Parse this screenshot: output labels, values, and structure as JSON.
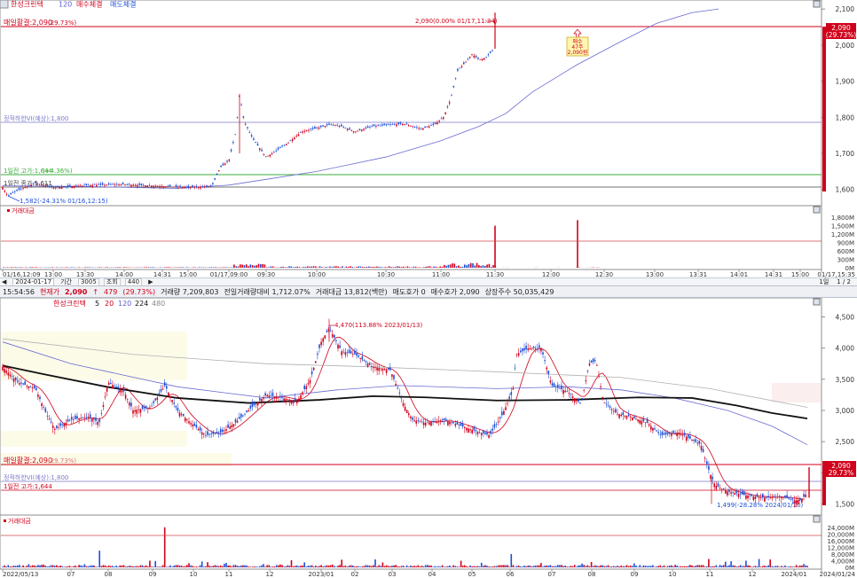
{
  "intraday": {
    "title_items": [
      "한성크린텍",
      "120",
      "매수체결",
      "매도체결"
    ],
    "title_colors": [
      "#d0021b",
      "#5b5bd6",
      "#d0021b",
      "#1e4fd8"
    ],
    "price_ticks": [
      "2,100",
      "2,000",
      "1,900",
      "1,800",
      "1,700",
      "1,600"
    ],
    "price_tick_values": [
      2100,
      2000,
      1900,
      1800,
      1700,
      1600
    ],
    "time_labels": [
      "01/16,12:09",
      "13:00",
      "13:30",
      "14:00",
      "14:31",
      "15:00",
      "01/17,09:00",
      "09:30",
      "10:00",
      "10:30",
      "11:00",
      "11:30",
      "12:00",
      "12:30",
      "13:00",
      "13:31",
      "14:01",
      "14:31",
      "15:00",
      "01/17,15:35"
    ],
    "labels": {
      "limit_up": "매일활결:2,090",
      "limit_up_sub": "(29.73%)",
      "upper_line": "정적하한VI(예상):1,800",
      "prev_high": "1일전 고가:1,644",
      "prev_high_sub": "(+4.36%)",
      "prev_close": "1일전 종가:1,611",
      "low_ann": "1,582(-24.31% 01/16,12:15)",
      "high_ann": "2,090(0.00% 01/17,11:34)",
      "buy_box": [
        "매수",
        "47주",
        "2,090원"
      ],
      "last_price": "2,090",
      "last_pct": "(29.73%)"
    },
    "volume_label": "거래대금",
    "volume_ticks": [
      "1,800M",
      "1,500M",
      "1,200M",
      "900M",
      "600M",
      "300M",
      "0M"
    ]
  },
  "controls": {
    "date": "2024-01-17",
    "period": "기간",
    "count": "3005",
    "lookup": "조회",
    "count2": "440",
    "page": "1일",
    "pager": "1 / 2"
  },
  "infobar": {
    "time": "15:54:56",
    "label_current": "현재가",
    "current_price": "2,090",
    "arrow": "↑",
    "change": "479",
    "change_pct": "(29.73%)",
    "volume": "거래량 7,209,803",
    "vol_ratio": "전일거래량대비 1,712.07%",
    "amount": "거래대금 13,812(백만)",
    "ask": "매도호가 0",
    "bid": "매수호가 2,090",
    "shares": "상장주수 50,035,429"
  },
  "daily": {
    "title_items": [
      "한성크린텍",
      "5",
      "20",
      "120",
      "224",
      "480"
    ],
    "title_colors": [
      "#d0021b",
      "#111111",
      "#d0021b",
      "#5b5bd6",
      "#111111",
      "#8a8a8a"
    ],
    "price_ticks": [
      "4,500",
      "4,000",
      "3,500",
      "3,000",
      "2,500",
      "2,000",
      "1,500"
    ],
    "price_tick_values": [
      4500,
      4000,
      3500,
      3000,
      2500,
      2000,
      1500
    ],
    "time_labels": [
      "2022/05/13",
      "07",
      "08",
      "09",
      "10",
      "11",
      "12",
      "2023/01",
      "02",
      "03",
      "04",
      "05",
      "06",
      "07",
      "08",
      "09",
      "10",
      "11",
      "12",
      "2024/01",
      "2024/01/24"
    ],
    "labels": {
      "limit_up": "매일활결:2,090",
      "limit_up_sub": "(29.73%)",
      "upper_line": "정적하한VI(예상):1,800",
      "prev_high": "1일전 고가:1,644",
      "high_ann": "4,470(113.88% 2023/01/13)",
      "low_ann": "1,499(-28.28% 2024/01/10)",
      "last_price": "2,090",
      "last_pct": "29.73%"
    },
    "volume_label": "거래대금",
    "volume_ticks": [
      "24,000M",
      "20,000M",
      "16,000M",
      "12,000M",
      "8,000M",
      "4,000M",
      "0M"
    ]
  },
  "chart_data": [
    {
      "type": "candlestick",
      "title": "한성크린텍",
      "x_range": [
        "01/16,12:09",
        "01/17,15:35"
      ],
      "ylim": [
        1560,
        2120
      ],
      "key_points": [
        {
          "label": "low",
          "x": "01/16,12:15",
          "y": 1582
        },
        {
          "label": "open_01/17",
          "x": "01/17,09:00",
          "y": 1650
        },
        {
          "label": "spike",
          "x": "01/17,09:15",
          "y": 1865
        },
        {
          "label": "09:30",
          "x": "01/17,09:30",
          "y": 1680
        },
        {
          "label": "10:00",
          "x": "01/17,10:00",
          "y": 1770
        },
        {
          "label": "10:30",
          "x": "01/17,10:30",
          "y": 1775
        },
        {
          "label": "11:00",
          "x": "01/17,11:00",
          "y": 1810
        },
        {
          "label": "11:15",
          "x": "01/17,11:15",
          "y": 1960
        },
        {
          "label": "high",
          "x": "01/17,11:34",
          "y": 2090
        }
      ],
      "reference_lines": [
        2090,
        1800,
        1644,
        1611
      ],
      "volume_ylim": [
        0,
        1900
      ],
      "volume_spikes_M": [
        {
          "x": "01/17,11:34",
          "y": 1500
        },
        {
          "x": "01/17,12:20",
          "y": 1700
        }
      ]
    },
    {
      "type": "candlestick",
      "title": "한성크린텍",
      "x_range": [
        "2022/05/13",
        "2024/01/24"
      ],
      "ylim": [
        1350,
        4750
      ],
      "key_points": [
        {
          "x": "2022/05",
          "y": 3700
        },
        {
          "x": "2022/07",
          "y": 2750
        },
        {
          "x": "2022/08",
          "y": 3450
        },
        {
          "x": "2022/09",
          "y": 3000
        },
        {
          "x": "2022/10",
          "y": 2600
        },
        {
          "x": "2022/12",
          "y": 3150
        },
        {
          "x": "2023/01/13",
          "y": 4470
        },
        {
          "x": "2023/03",
          "y": 3650
        },
        {
          "x": "2023/04",
          "y": 2800
        },
        {
          "x": "2023/05",
          "y": 2600
        },
        {
          "x": "2023/06",
          "y": 4050
        },
        {
          "x": "2023/07",
          "y": 3300
        },
        {
          "x": "2023/08",
          "y": 3800
        },
        {
          "x": "2023/09",
          "y": 3000
        },
        {
          "x": "2023/10",
          "y": 2700
        },
        {
          "x": "2023/11",
          "y": 2200
        },
        {
          "x": "2023/12",
          "y": 1650
        },
        {
          "x": "2024/01/10",
          "y": 1499
        },
        {
          "x": "2024/01/17",
          "y": 2090
        }
      ],
      "reference_lines": [
        2090,
        1800,
        1644
      ],
      "volume_ylim": [
        0,
        26000
      ]
    }
  ]
}
